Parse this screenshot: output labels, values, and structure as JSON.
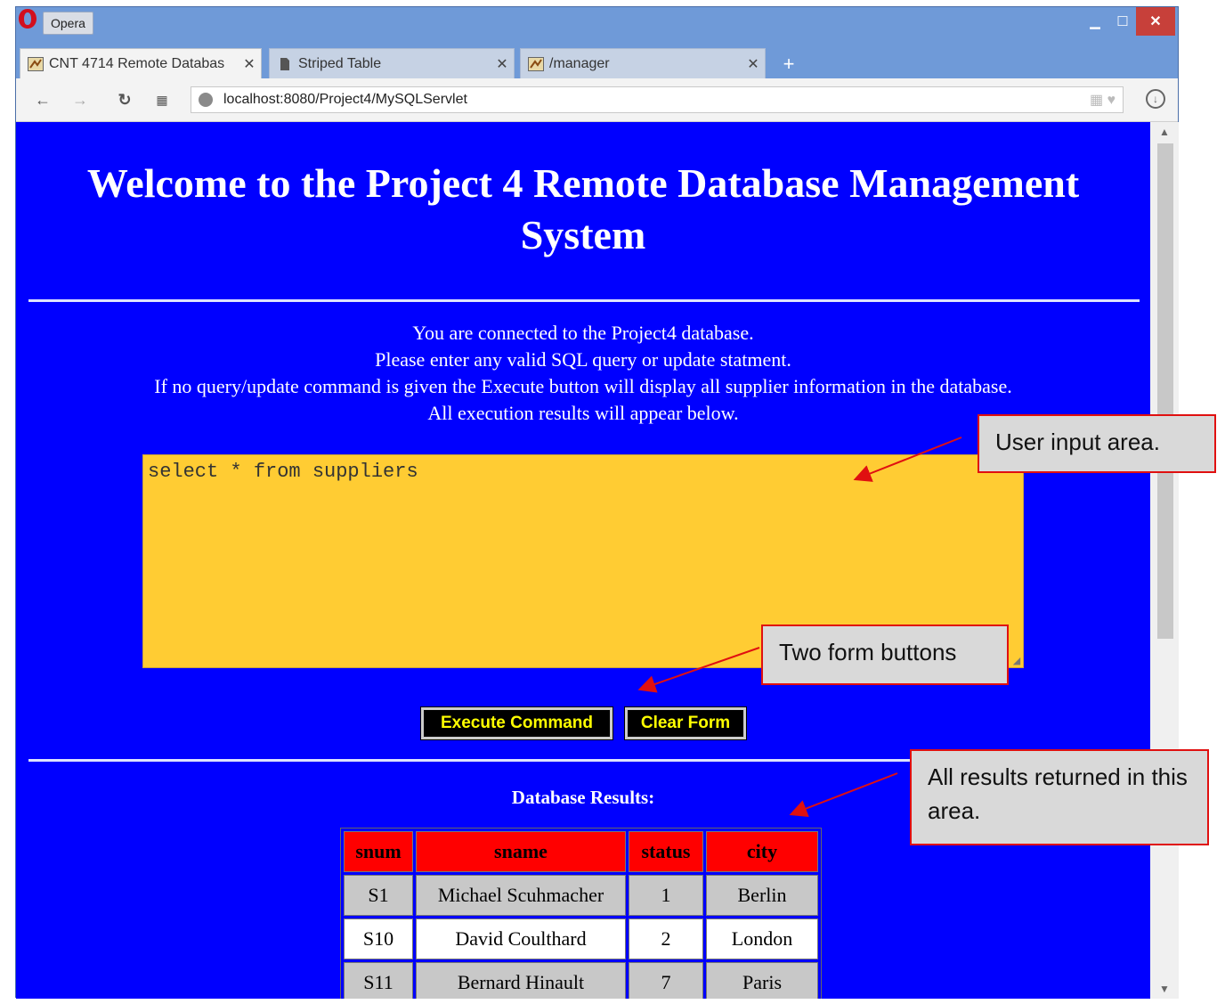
{
  "browser": {
    "menu_label": "Opera",
    "tabs": [
      {
        "label": "CNT 4714 Remote Databas",
        "close": "✕",
        "icon": "servlet-icon",
        "active": true
      },
      {
        "label": "Striped Table",
        "close": "✕",
        "icon": "document-icon",
        "active": false
      },
      {
        "label": "/manager",
        "close": "✕",
        "icon": "servlet-icon",
        "active": false
      }
    ],
    "new_tab": "+",
    "url": "localhost:8080/Project4/MySQLServlet"
  },
  "page": {
    "heading_line1": "Welcome to the Project 4 Remote Database Management",
    "heading_line2": "System",
    "intro": [
      "You are connected to the Project4 database.",
      "Please enter any valid SQL query or update statment.",
      "If no query/update command is given the Execute button will display all supplier information in the database.",
      "All execution results will appear below."
    ],
    "query_value": "select * from suppliers",
    "execute_label": "Execute Command",
    "clear_label": "Clear Form",
    "results_label": "Database Results:",
    "table": {
      "headers": [
        "snum",
        "sname",
        "status",
        "city"
      ],
      "rows": [
        [
          "S1",
          "Michael Scuhmacher",
          "1",
          "Berlin"
        ],
        [
          "S10",
          "David Coulthard",
          "2",
          "London"
        ],
        [
          "S11",
          "Bernard Hinault",
          "7",
          "Paris"
        ]
      ]
    }
  },
  "annotations": {
    "input_area": "User input area.",
    "form_buttons": "Two form buttons",
    "results_area": "All results returned in this area."
  },
  "colors": {
    "page_background": "#0000ff",
    "textarea_background": "#ffcc33",
    "header_row": "#ff0000",
    "button_text": "#ffff00",
    "callout_border": "#e01010"
  }
}
